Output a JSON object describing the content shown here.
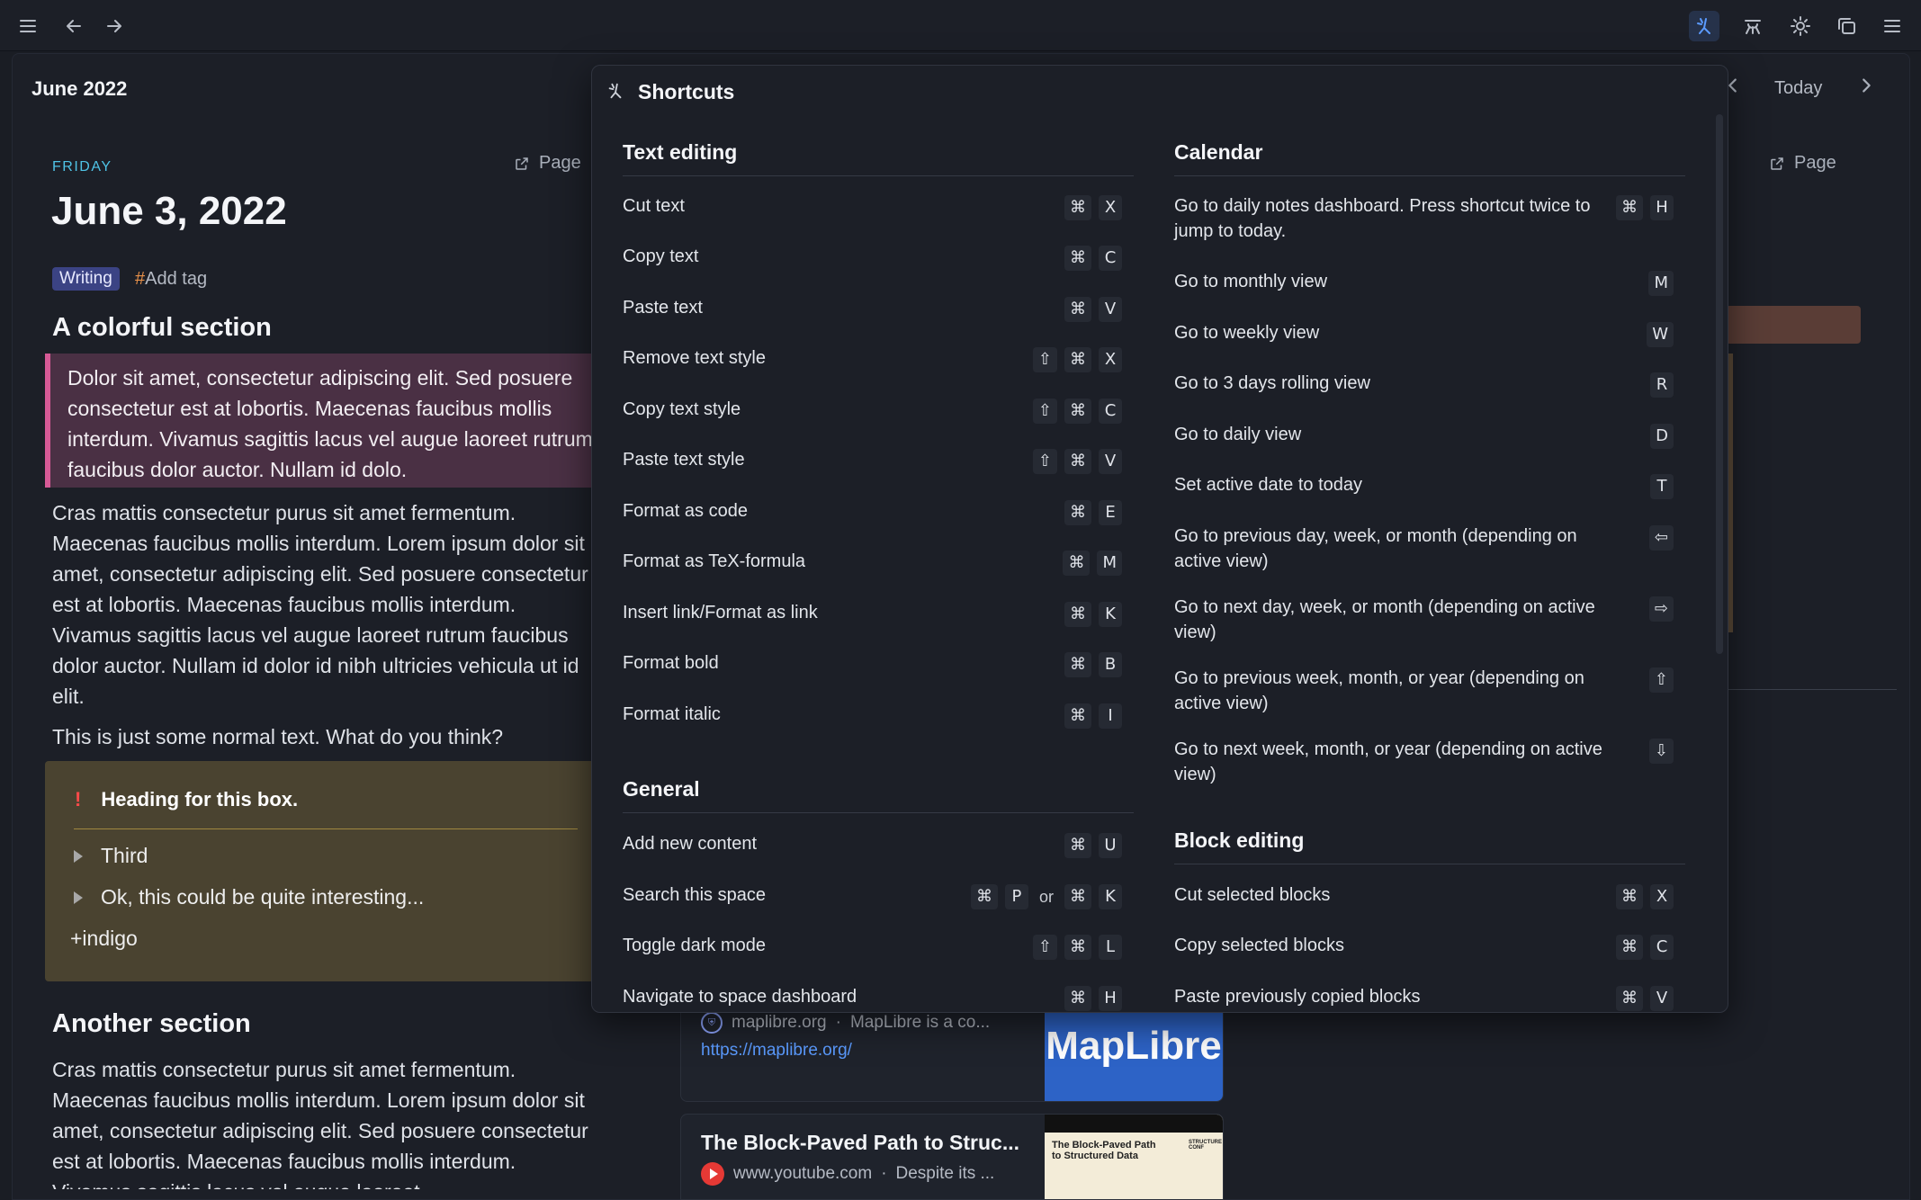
{
  "topbar": {
    "icons": [
      "menu-icon",
      "back-arrow-icon",
      "forward-arrow-icon",
      "shortcuts-icon",
      "graph-icon",
      "theme-sun-icon",
      "windows-icon",
      "more-menu-icon"
    ]
  },
  "calendar": {
    "month": "June 2022",
    "today_label": "Today"
  },
  "day": {
    "weekday": "FRIDAY",
    "date": "June 3, 2022",
    "page_label": "Page",
    "tag": "Writing",
    "add_tag_hash": "#",
    "add_tag": "Add tag",
    "section1": "A colorful section",
    "pink_text": "Dolor sit amet, consectetur adipiscing elit. Sed posuere consectetur est at lobortis. Maecenas faucibus mollis interdum. Vivamus sagittis lacus vel augue laoreet rutrum faucibus dolor auctor. Nullam id dolo.",
    "para1": "Cras mattis consectetur purus sit amet fermentum. Maecenas faucibus mollis interdum. Lorem ipsum dolor sit amet, consectetur adipiscing elit. Sed posuere consectetur est at lobortis. Maecenas faucibus mollis interdum. Vivamus sagittis lacus vel augue laoreet rutrum faucibus dolor auctor. Nullam id dolor id nibh ultricies vehicula ut id elit.",
    "para2": "This is just some normal text. What do you think?",
    "box_mark": "!",
    "box_heading": "Heading for this box.",
    "box_item1": "Third",
    "box_item2": "Ok, this could be quite interesting...",
    "box_tag": "+indigo",
    "section2": "Another section",
    "para3": "Cras mattis consectetur purus sit amet fermentum. Maecenas faucibus mollis interdum. Lorem ipsum dolor sit amet, consectetur adipiscing elit. Sed posuere consectetur est at lobortis. Maecenas faucibus mollis interdum. Vivamus sagittis lacus vel augue laoreet"
  },
  "right_page_label": "Page",
  "links": [
    {
      "site": "maplibre.org",
      "sep": "·",
      "desc": "MapLibre is a co...",
      "url": "https://maplibre.org/",
      "thumb_text": "MapLibre"
    },
    {
      "title": "The Block-Paved Path to Struc...",
      "site": "www.youtube.com",
      "sep": "·",
      "desc": "Despite its ...",
      "thumb_text": "The Block-Paved Path to Structured Data",
      "thumb_corner": "STRUCTURE CONF"
    }
  ],
  "shortcuts": {
    "title": "Shortcuts",
    "text_editing": {
      "heading": "Text editing",
      "rows": [
        {
          "label": "Cut text",
          "keys": [
            "⌘",
            "X"
          ]
        },
        {
          "label": "Copy text",
          "keys": [
            "⌘",
            "C"
          ]
        },
        {
          "label": "Paste text",
          "keys": [
            "⌘",
            "V"
          ]
        },
        {
          "label": "Remove text style",
          "keys": [
            "⇧",
            "⌘",
            "X"
          ]
        },
        {
          "label": "Copy text style",
          "keys": [
            "⇧",
            "⌘",
            "C"
          ]
        },
        {
          "label": "Paste text style",
          "keys": [
            "⇧",
            "⌘",
            "V"
          ]
        },
        {
          "label": "Format as code",
          "keys": [
            "⌘",
            "E"
          ]
        },
        {
          "label": "Format as TeX-formula",
          "keys": [
            "⌘",
            "M"
          ]
        },
        {
          "label": "Insert link/Format as link",
          "keys": [
            "⌘",
            "K"
          ]
        },
        {
          "label": "Format bold",
          "keys": [
            "⌘",
            "B"
          ]
        },
        {
          "label": "Format italic",
          "keys": [
            "⌘",
            "I"
          ]
        }
      ]
    },
    "general": {
      "heading": "General",
      "rows": [
        {
          "label": "Add new content",
          "keys": [
            "⌘",
            "U"
          ]
        },
        {
          "label": "Search this space",
          "keys": [
            "⌘",
            "P",
            "or",
            "⌘",
            "K"
          ]
        },
        {
          "label": "Toggle dark mode",
          "keys": [
            "⇧",
            "⌘",
            "L"
          ]
        },
        {
          "label": "Navigate to space dashboard",
          "keys": [
            "⌘",
            "H"
          ]
        }
      ]
    },
    "calendar": {
      "heading": "Calendar",
      "rows": [
        {
          "label": "Go to daily notes dashboard. Press shortcut twice to jump to today.",
          "keys": [
            "⌘",
            "H"
          ]
        },
        {
          "label": "Go to monthly view",
          "keys": [
            "M"
          ]
        },
        {
          "label": "Go to weekly view",
          "keys": [
            "W"
          ]
        },
        {
          "label": "Go to 3 days rolling view",
          "keys": [
            "R"
          ]
        },
        {
          "label": "Go to daily view",
          "keys": [
            "D"
          ]
        },
        {
          "label": "Set active date to today",
          "keys": [
            "T"
          ]
        },
        {
          "label": "Go to previous day, week, or month (depending on active view)",
          "keys": [
            "⇦"
          ]
        },
        {
          "label": "Go to next day, week, or month (depending on active view)",
          "keys": [
            "⇨"
          ]
        },
        {
          "label": "Go to previous week, month, or year (depending on active view)",
          "keys": [
            "⇧"
          ]
        },
        {
          "label": "Go to next week, month, or year (depending on active view)",
          "keys": [
            "⇩"
          ]
        }
      ]
    },
    "block_editing": {
      "heading": "Block editing",
      "rows": [
        {
          "label": "Cut selected blocks",
          "keys": [
            "⌘",
            "X"
          ]
        },
        {
          "label": "Copy selected blocks",
          "keys": [
            "⌘",
            "C"
          ]
        },
        {
          "label": "Paste previously copied blocks",
          "keys": [
            "⌘",
            "V"
          ]
        }
      ]
    }
  }
}
